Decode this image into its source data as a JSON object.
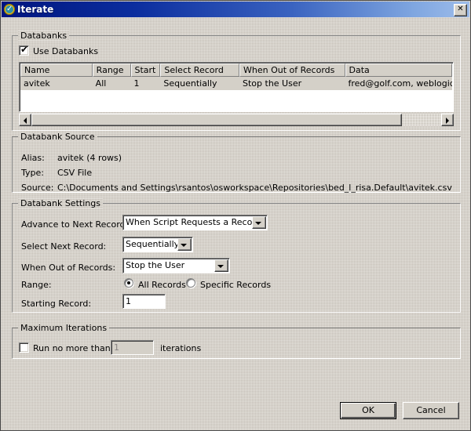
{
  "window": {
    "title": "Iterate",
    "icon": "iterate-badge-icon",
    "close_label": "✕"
  },
  "databanks_group": {
    "title": "Databanks",
    "use_databanks_label": "Use Databanks",
    "use_databanks_checked": true,
    "checkmark": "✔",
    "table": {
      "columns": [
        "Name",
        "Range",
        "Start",
        "Select Record",
        "When Out of Records",
        "Data"
      ],
      "rows": [
        {
          "name": "avitek",
          "range": "All",
          "start": "1",
          "select_record": "Sequentially",
          "when_out_of_records": "Stop the User",
          "data": "fred@golf.com, weblogic"
        }
      ]
    }
  },
  "databank_source_group": {
    "title": "Databank Source",
    "alias_label": "Alias:",
    "alias_value": "avitek (4 rows)",
    "type_label": "Type:",
    "type_value": "CSV File",
    "source_label": "Source:",
    "source_value": "C:\\Documents and Settings\\rsantos\\osworkspace\\Repositories\\bed_l_risa.Default\\avitek.csv"
  },
  "databank_settings_group": {
    "title": "Databank Settings",
    "advance_label": "Advance to Next Record:",
    "advance_value": "When Script Requests a Record",
    "select_next_label": "Select Next Record:",
    "select_next_value": "Sequentially",
    "when_out_label": "When Out of Records:",
    "when_out_value": "Stop the User",
    "range_label": "Range:",
    "range_all_label": "All Records",
    "range_specific_label": "Specific Records",
    "range_selected": "All Records",
    "starting_record_label": "Starting Record:",
    "starting_record_value": "1"
  },
  "maximum_iterations_group": {
    "title": "Maximum Iterations",
    "run_no_more_than_label": "Run no more than",
    "run_no_more_than_checked": false,
    "iterations_value": "1",
    "iterations_label": "iterations",
    "iterations_disabled": true
  },
  "buttons": {
    "ok_label": "OK",
    "cancel_label": "Cancel"
  },
  "colors": {
    "dialog_bg": "#d8d4cc",
    "titlebar_start": "#00157f",
    "titlebar_end": "#9dbcea",
    "field_bg": "#ffffff",
    "control_face": "#d4d0c8"
  }
}
